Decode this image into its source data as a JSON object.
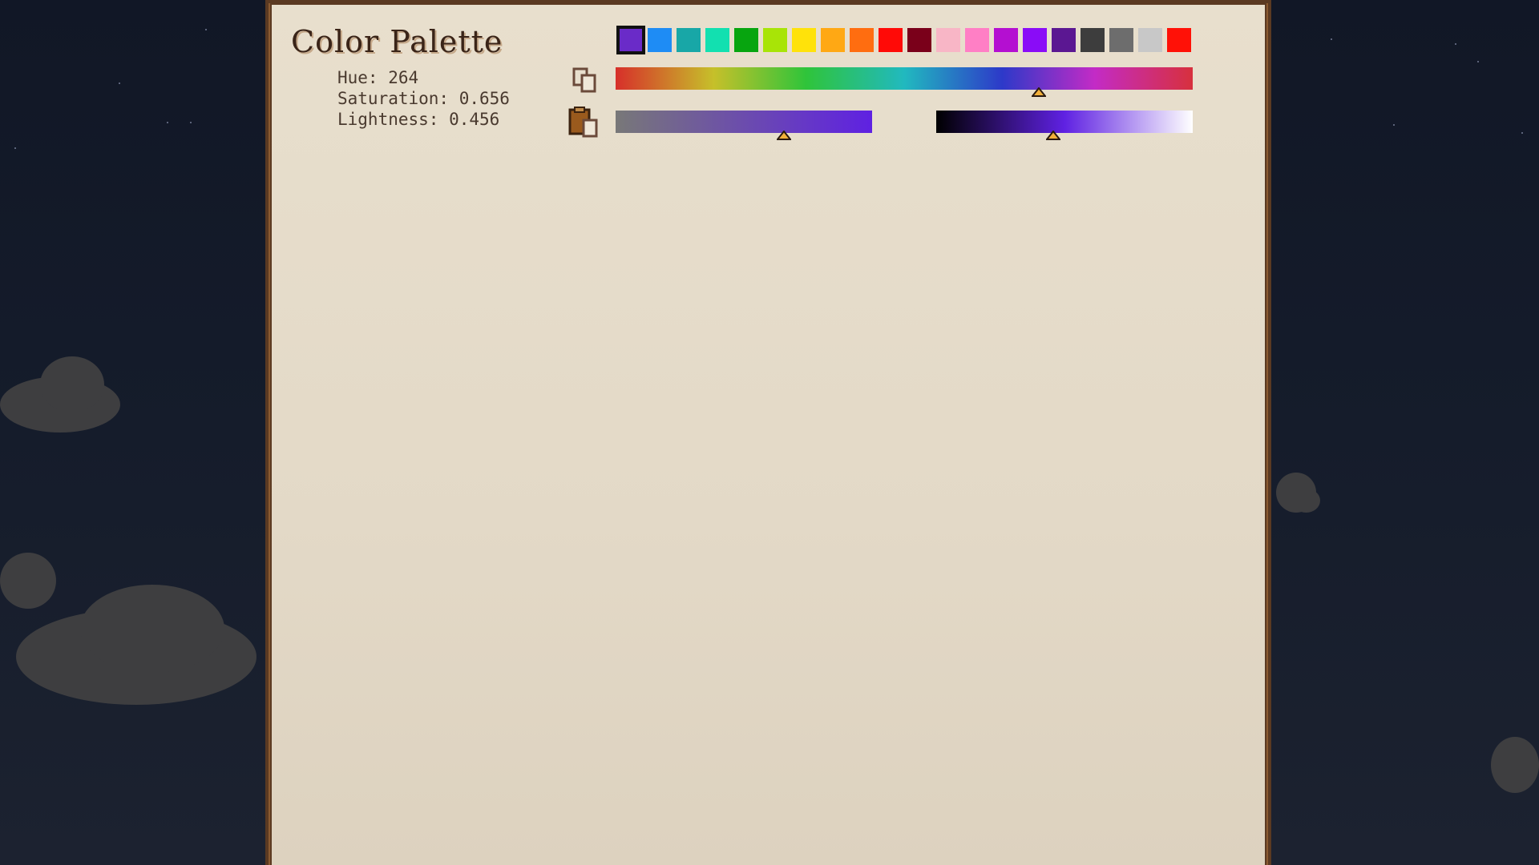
{
  "panel": {
    "title": "Color Palette",
    "readout": {
      "hue": "Hue: 264",
      "saturation": "Saturation: 0.656",
      "lightness": "Lightness: 0.456"
    },
    "values": {
      "hue": 264,
      "saturation": 0.656,
      "lightness": 0.456
    },
    "icons": {
      "copy": "copy-icon",
      "paste": "paste-icon"
    },
    "swatches": [
      "#6a2bc8",
      "#1e8cf5",
      "#18a7a7",
      "#12e0b0",
      "#07a50f",
      "#a8e407",
      "#ffe20a",
      "#ffa814",
      "#ff6d10",
      "#ff0a07",
      "#7a001a",
      "#f8b6c6",
      "#ff7fc5",
      "#b40fd1",
      "#8a0cf7",
      "#5b1792",
      "#3d3d3d",
      "#6d6d6d",
      "#c8c8c8",
      "#ff1107"
    ],
    "selected_swatch_index": 0,
    "slider_fractions": {
      "hue": 0.733,
      "saturation": 0.656,
      "lightness": 0.456
    }
  }
}
